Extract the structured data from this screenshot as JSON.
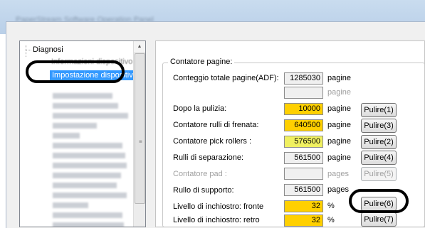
{
  "window": {
    "title": "PaperStream Software Operation Panel"
  },
  "tree": {
    "root": "Diagnosi",
    "faded_item": "Informazioni dispositivo",
    "selected_item": "Impostazione dispositivo"
  },
  "counter": {
    "group_title": "Contatore pagine:",
    "rows": [
      {
        "label": "Conteggio totale pagine(ADF):",
        "value": "1285030",
        "unit": "pagine",
        "button": ""
      },
      {
        "label": "",
        "value": "",
        "unit": "pagine",
        "button": ""
      },
      {
        "label": "Dopo la pulizia:",
        "value": "10000",
        "unit": "pagine",
        "button": "Pulire(1)"
      },
      {
        "label": "Contatore rulli di frenata:",
        "value": "640500",
        "unit": "pagine",
        "button": "Pulire(3)"
      },
      {
        "label": "Contatore pick rollers :",
        "value": "576500",
        "unit": "pagine",
        "button": "Pulire(2)"
      },
      {
        "label": "Rulli di separazione:",
        "value": "561500",
        "unit": "pagine",
        "button": "Pulire(4)"
      },
      {
        "label": "Contatore pad :",
        "value": "",
        "unit": "pages",
        "button": "Pulire(5)"
      },
      {
        "label": "Rullo di supporto:",
        "value": "561500",
        "unit": "pages",
        "button": ""
      },
      {
        "label": "Livello di inchiostro: fronte",
        "value": "32",
        "unit": "%",
        "button": "Pulire(6)"
      },
      {
        "label": "Livello di inchiostro: retro",
        "value": "32",
        "unit": "%",
        "button": "Pulire(7)"
      }
    ]
  },
  "colors": {
    "warning": "#ffd000",
    "caution": "#f0f060",
    "selection": "#3399ff"
  }
}
